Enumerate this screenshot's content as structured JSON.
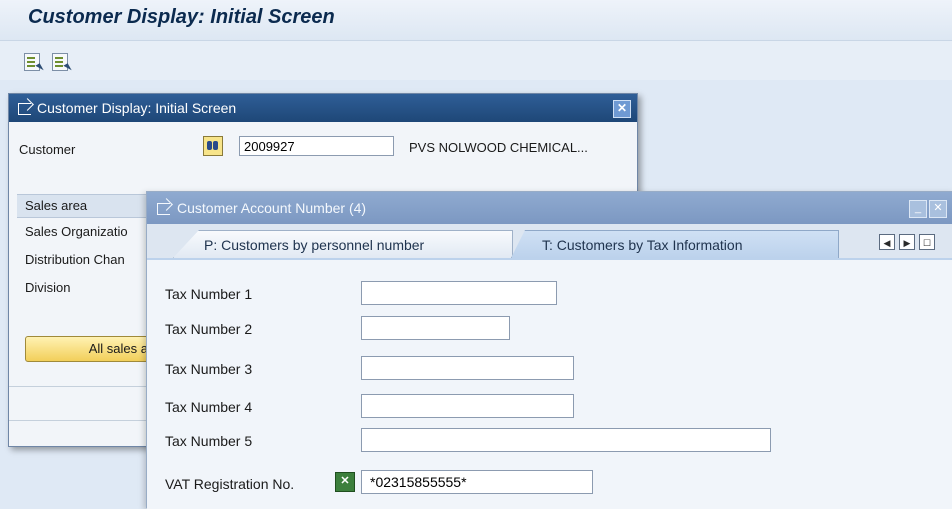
{
  "window": {
    "title": "Customer Display: Initial Screen"
  },
  "toolbar": {
    "icons": [
      "execute-icon",
      "execute-alt-icon"
    ]
  },
  "dialog_main": {
    "title": "Customer Display: Initial Screen",
    "customer_label": "Customer",
    "customer_value": "2009927",
    "customer_name": "PVS NOLWOOD CHEMICAL...",
    "sales_area_header": "Sales area",
    "rows": [
      "Sales Organizatio",
      "Distribution Chan",
      "Division"
    ],
    "all_sales_button": "All sales a"
  },
  "dialog_search": {
    "title": "Customer Account Number (4)",
    "tabs": [
      "P: Customers by personnel number",
      "T: Customers by Tax Information"
    ],
    "fields": [
      {
        "label": "Tax Number 1",
        "value": ""
      },
      {
        "label": "Tax Number 2",
        "value": ""
      },
      {
        "label": "Tax Number 3",
        "value": ""
      },
      {
        "label": "Tax Number 4",
        "value": ""
      },
      {
        "label": "Tax Number 5",
        "value": ""
      },
      {
        "label": "VAT Registration No.",
        "value": "*02315855555*"
      }
    ]
  }
}
